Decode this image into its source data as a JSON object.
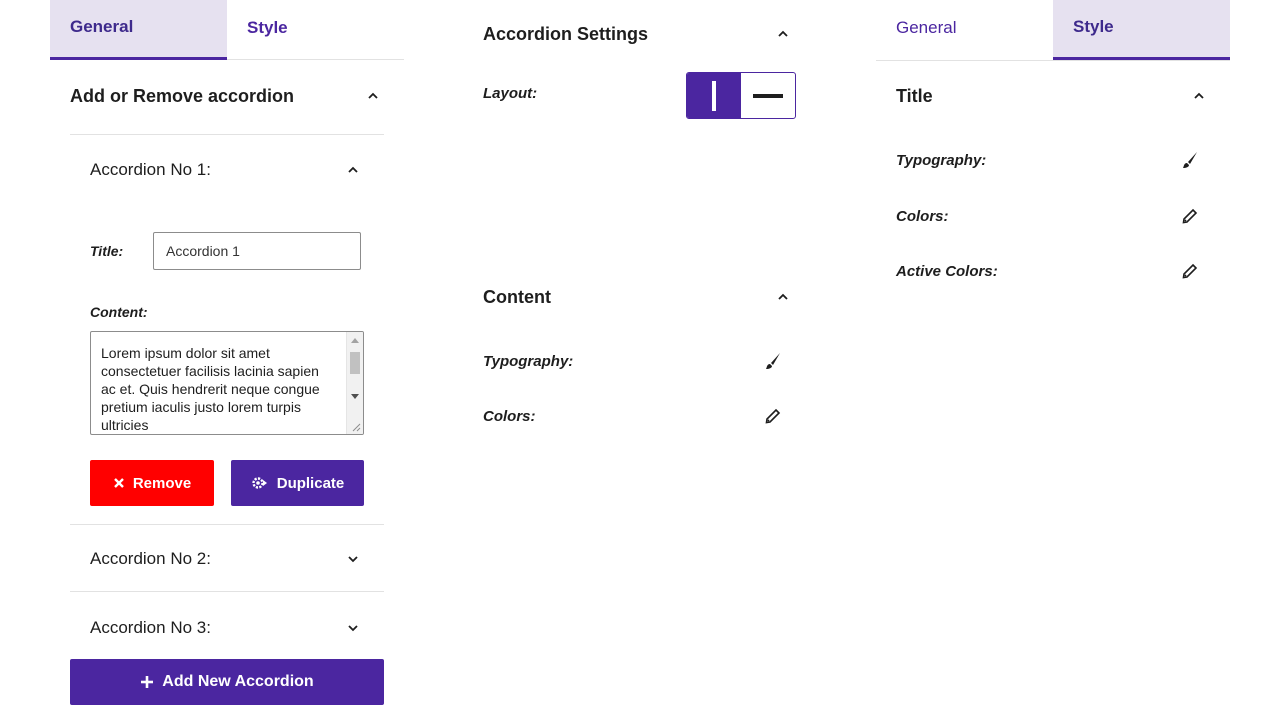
{
  "panel_general": {
    "tabs": [
      {
        "label": "General",
        "active": true
      },
      {
        "label": "Style",
        "active": false
      }
    ],
    "section_title": "Add or Remove accordion",
    "accordion_1": {
      "header": "Accordion No 1:",
      "title_label": "Title:",
      "title_value": "Accordion 1",
      "content_label": "Content:",
      "content_value": "Lorem ipsum dolor sit amet consectetuer facilisis lacinia sapien ac et. Quis hendrerit neque congue pretium iaculis justo lorem turpis ultricies",
      "remove_label": "Remove",
      "duplicate_label": "Duplicate"
    },
    "accordion_2": {
      "header": "Accordion No 2:"
    },
    "accordion_3": {
      "header": "Accordion No 3:"
    },
    "add_button_label": "Add New Accordion"
  },
  "panel_settings": {
    "accordion_settings_title": "Accordion Settings",
    "layout_label": "Layout:",
    "layout_selected": "vertical",
    "content_title": "Content",
    "typography_label": "Typography:",
    "colors_label": "Colors:"
  },
  "panel_style": {
    "tabs": [
      {
        "label": "General",
        "active": false
      },
      {
        "label": "Style",
        "active": true
      }
    ],
    "title_section": "Title",
    "typography_label": "Typography:",
    "colors_label": "Colors:",
    "active_colors_label": "Active Colors:"
  },
  "colors": {
    "accent": "#4b26a0",
    "tab_active_bg": "#e6e1f0",
    "danger": "#ff0000"
  },
  "icons": {
    "chevron_up": "chevron-up-icon",
    "chevron_down": "chevron-down-icon",
    "brush": "brush-icon",
    "pencil": "pencil-icon",
    "close": "close-icon",
    "duplicate": "gear-duplicate-icon",
    "plus": "plus-icon"
  }
}
